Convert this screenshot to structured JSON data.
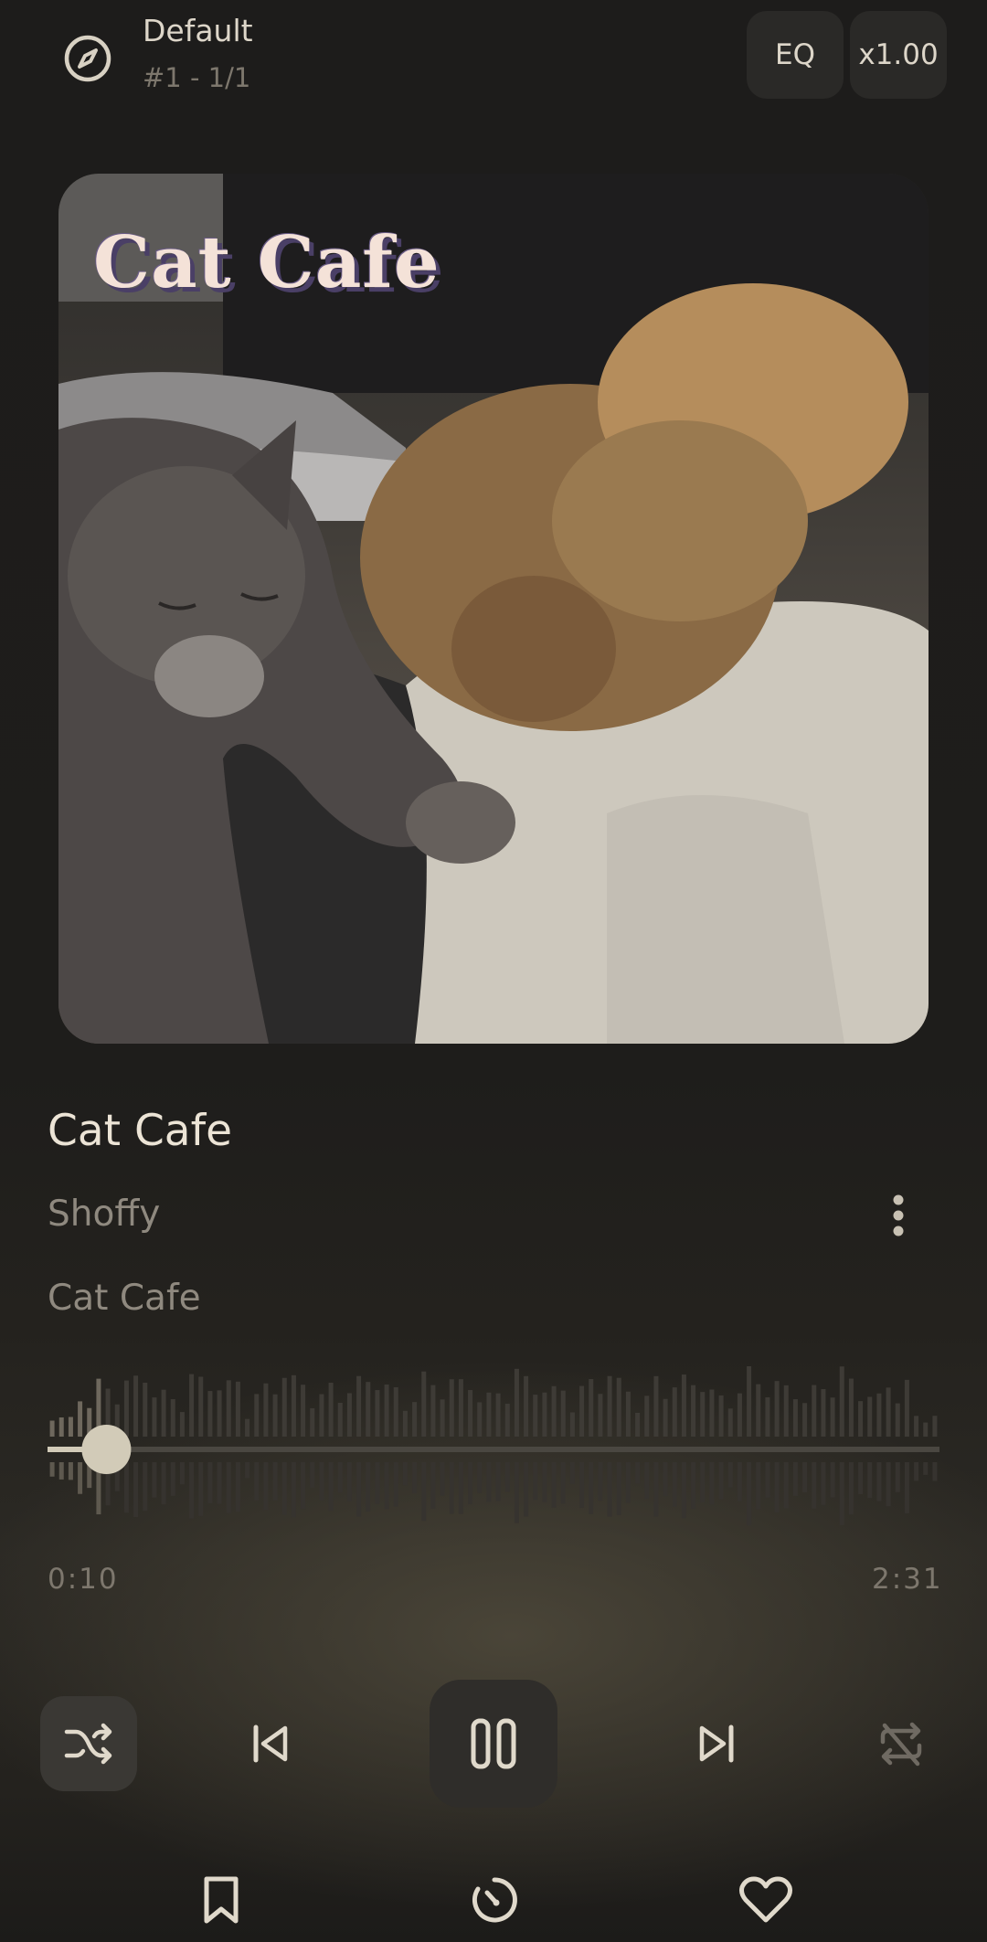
{
  "header": {
    "queue_name": "Default",
    "queue_position": "#1 - 1/1",
    "eq_label": "EQ",
    "speed_label": "x1.00",
    "compass_icon": "compass-icon"
  },
  "artwork": {
    "title_text": "Cat Cafe"
  },
  "track": {
    "title": "Cat Cafe",
    "artist": "Shoffy",
    "album": "Cat Cafe",
    "more_icon": "more-vertical-icon"
  },
  "playback": {
    "current_time": "0:10",
    "total_time": "2:31",
    "progress": 0.066
  },
  "controls": {
    "shuffle_icon": "shuffle-icon",
    "shuffle_active": true,
    "prev_icon": "skip-previous-icon",
    "play_state_icon": "pause-icon",
    "next_icon": "skip-next-icon",
    "repeat_icon": "repeat-off-icon"
  },
  "bottom_bar": {
    "bookmark_icon": "bookmark-icon",
    "timer_icon": "sleep-timer-icon",
    "favorite_icon": "heart-icon"
  },
  "colors": {
    "accent": "#d2cbb8",
    "text_primary": "#ece4d6",
    "text_secondary": "#8f897f",
    "pill_bg": "#2a2927"
  }
}
